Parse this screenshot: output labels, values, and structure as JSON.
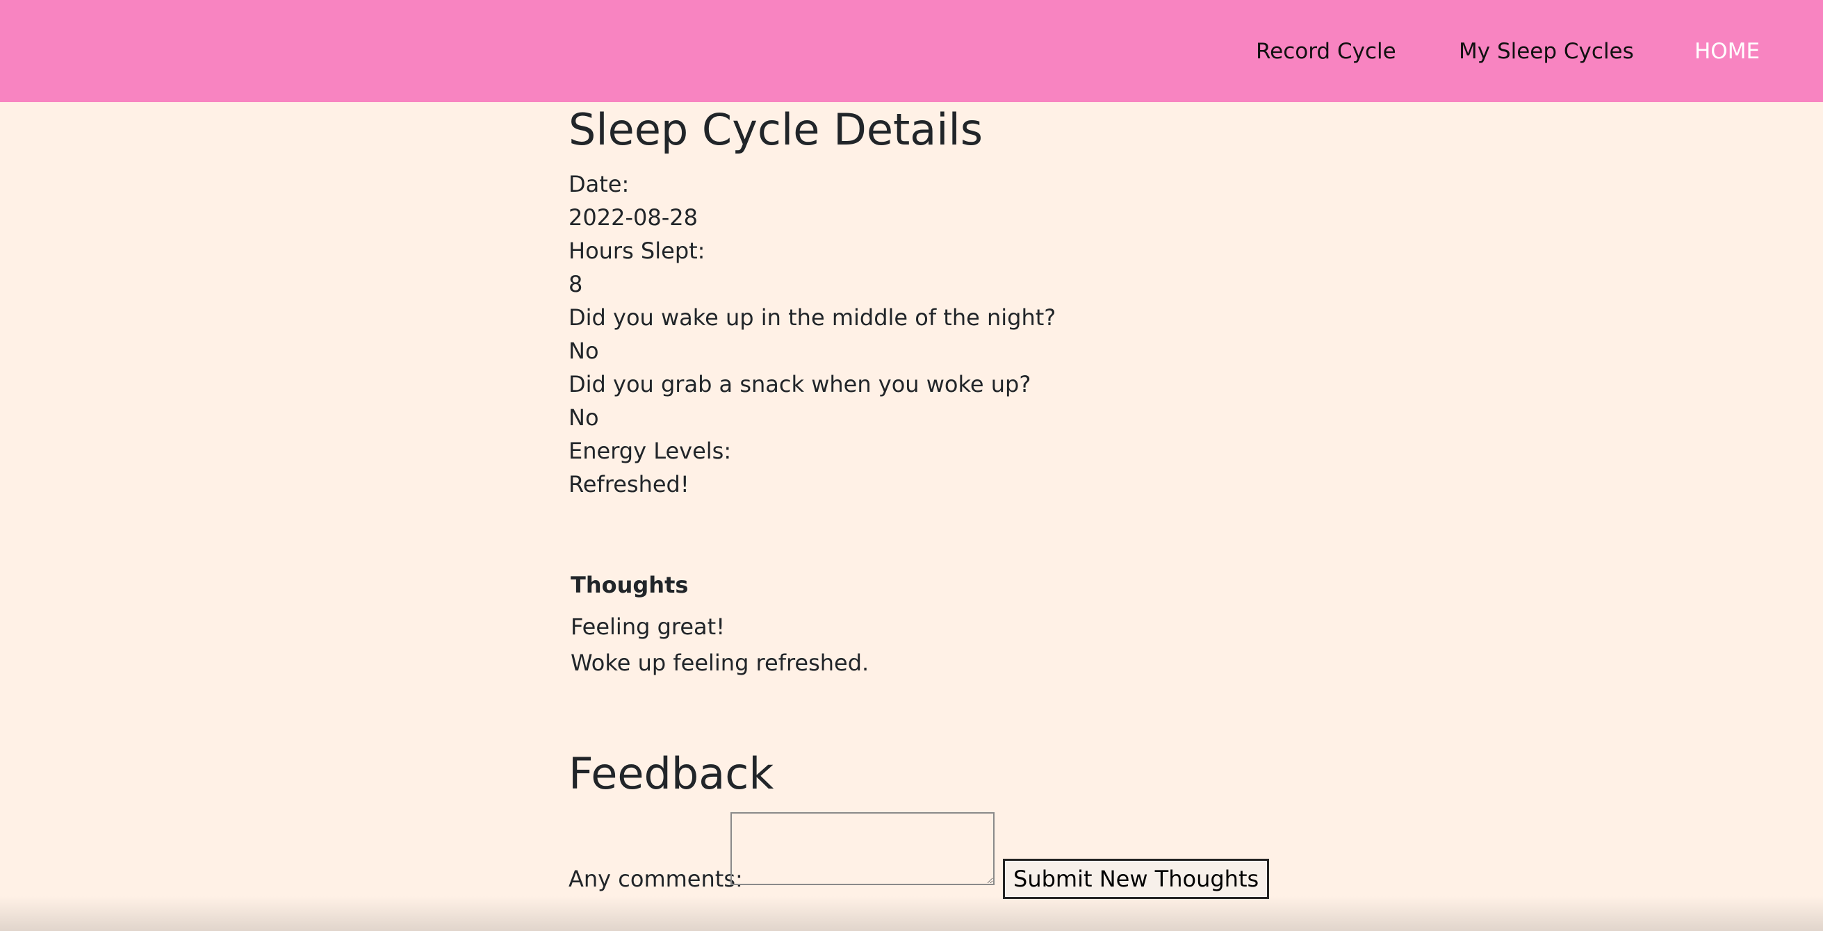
{
  "nav": {
    "record_cycle": "Record Cycle",
    "my_sleep_cycles": "My Sleep Cycles",
    "home": "HOME"
  },
  "details": {
    "title": "Sleep Cycle Details",
    "date_label": "Date:",
    "date_value": "2022-08-28",
    "hours_label": "Hours Slept:",
    "hours_value": "8",
    "woke_label": "Did you wake up in the middle of the night?",
    "woke_value": "No",
    "snack_label": "Did you grab a snack when you woke up?",
    "snack_value": "No",
    "energy_label": "Energy Levels:",
    "energy_value": "Refreshed!"
  },
  "thoughts": {
    "title": "Thoughts",
    "items": [
      "Feeling great!",
      "Woke up feeling refreshed."
    ]
  },
  "feedback": {
    "title": "Feedback",
    "comments_label": "Any comments:",
    "comments_value": "",
    "submit_label": "Submit New Thoughts"
  },
  "colors": {
    "navbar": "#f884c1",
    "background": "#fff1e6",
    "text": "#212529"
  }
}
